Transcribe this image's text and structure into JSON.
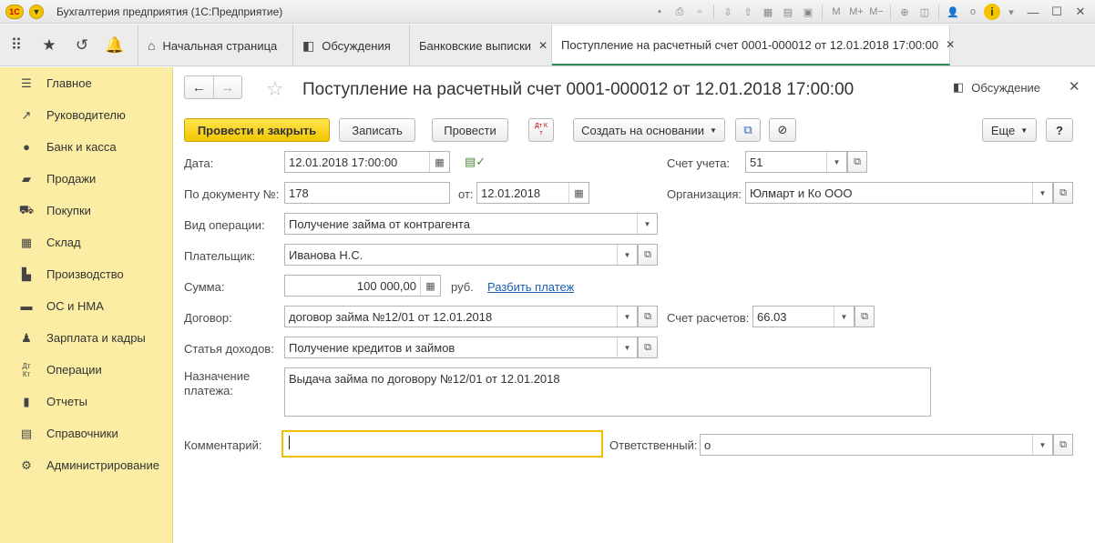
{
  "app": {
    "logo": "1С",
    "title": "Бухгалтерия предприятия  (1С:Предприятие)"
  },
  "window_user": "о",
  "tabs": [
    {
      "label": "Начальная страница",
      "icon": "home-icon",
      "closable": false
    },
    {
      "label": "Обсуждения",
      "icon": "chat-icon",
      "closable": false
    },
    {
      "label": "Банковские выписки",
      "icon": "",
      "closable": true
    },
    {
      "label": "Поступление на расчетный счет 0001-000012 от 12.01.2018 17:00:00",
      "icon": "",
      "closable": true,
      "active": true
    }
  ],
  "sidebar": {
    "items": [
      {
        "label": "Главное",
        "icon": "menu-icon"
      },
      {
        "label": "Руководителю",
        "icon": "trend-icon"
      },
      {
        "label": "Банк и касса",
        "icon": "coin-icon"
      },
      {
        "label": "Продажи",
        "icon": "bag-icon"
      },
      {
        "label": "Покупки",
        "icon": "cart-icon"
      },
      {
        "label": "Склад",
        "icon": "warehouse-icon"
      },
      {
        "label": "Производство",
        "icon": "factory-icon"
      },
      {
        "label": "ОС и НМА",
        "icon": "truck-icon"
      },
      {
        "label": "Зарплата и кадры",
        "icon": "person-icon"
      },
      {
        "label": "Операции",
        "icon": "dtkt-icon"
      },
      {
        "label": "Отчеты",
        "icon": "bar-chart-icon"
      },
      {
        "label": "Справочники",
        "icon": "book-icon"
      },
      {
        "label": "Администрирование",
        "icon": "gear-icon"
      }
    ]
  },
  "document": {
    "title": "Поступление на расчетный счет 0001-000012 от 12.01.2018 17:00:00",
    "discussion_label": "Обсуждение"
  },
  "toolbar": {
    "post_and_close": "Провести и закрыть",
    "save": "Записать",
    "post": "Провести",
    "dtkt": "Дт Кт",
    "create_based_on": "Создать на основании",
    "more": "Еще",
    "help": "?"
  },
  "form": {
    "date": {
      "label": "Дата:",
      "value": "12.01.2018 17:00:00"
    },
    "account": {
      "label": "Счет учета:",
      "value": "51"
    },
    "doc_number": {
      "label": "По документу №:",
      "value": "178"
    },
    "doc_date": {
      "label": "от:",
      "value": "12.01.2018"
    },
    "organization": {
      "label": "Организация:",
      "value": "Юлмарт и Ко ООО"
    },
    "operation_type": {
      "label": "Вид операции:",
      "value": "Получение займа от контрагента"
    },
    "payer": {
      "label": "Плательщик:",
      "value": "Иванова Н.С."
    },
    "amount": {
      "label": "Сумма:",
      "value": "100 000,00",
      "currency": "руб.",
      "split_link": "Разбить платеж"
    },
    "contract": {
      "label": "Договор:",
      "value": "договор займа №12/01 от 12.01.2018"
    },
    "settlement_account": {
      "label": "Счет расчетов:",
      "value": "66.03"
    },
    "income_item": {
      "label": "Статья доходов:",
      "value": "Получение кредитов и займов"
    },
    "purpose": {
      "label_line1": "Назначение",
      "label_line2": "платежа:",
      "value": "Выдача займа по договору №12/01 от 12.01.2018"
    },
    "comment": {
      "label": "Комментарий:",
      "value": ""
    },
    "responsible": {
      "label": "Ответственный:",
      "value": "о"
    }
  }
}
